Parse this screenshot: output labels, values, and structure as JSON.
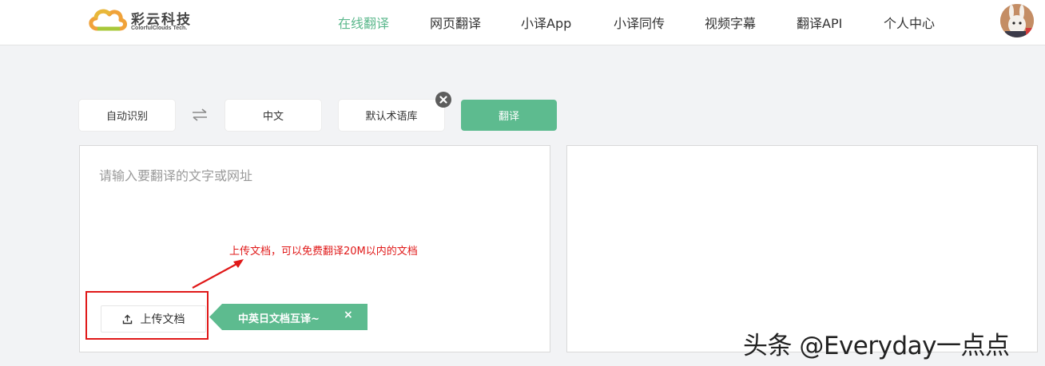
{
  "brand": {
    "name": "彩云科技",
    "subtitle": "ColorfulClouds Tech.",
    "colors": {
      "primary": "#5cb88d",
      "accent_orange": "#f0a23a"
    }
  },
  "nav": {
    "items": [
      {
        "label": "在线翻译",
        "active": true
      },
      {
        "label": "网页翻译",
        "active": false
      },
      {
        "label": "小译App",
        "active": false
      },
      {
        "label": "小译同传",
        "active": false
      },
      {
        "label": "视频字幕",
        "active": false
      },
      {
        "label": "翻译API",
        "active": false
      },
      {
        "label": "个人中心",
        "active": false
      }
    ]
  },
  "controls": {
    "source_lang": "自动识别",
    "swap_icon": "swap-arrows-icon",
    "target_lang": "中文",
    "glossary": "默认术语库",
    "glossary_close_icon": "close-circle-icon",
    "translate_button": "翻译"
  },
  "input_panel": {
    "placeholder": "请输入要翻译的文字或网址",
    "value": "",
    "upload_button": "上传文档",
    "upload_icon": "upload-icon",
    "promo_tag": "中英日文档互译~",
    "promo_close": "×"
  },
  "annotation": {
    "text": "上传文档，可以免费翻译20M以内的文档",
    "color": "#e01818"
  },
  "watermark": "头条 @Everyday一点点"
}
